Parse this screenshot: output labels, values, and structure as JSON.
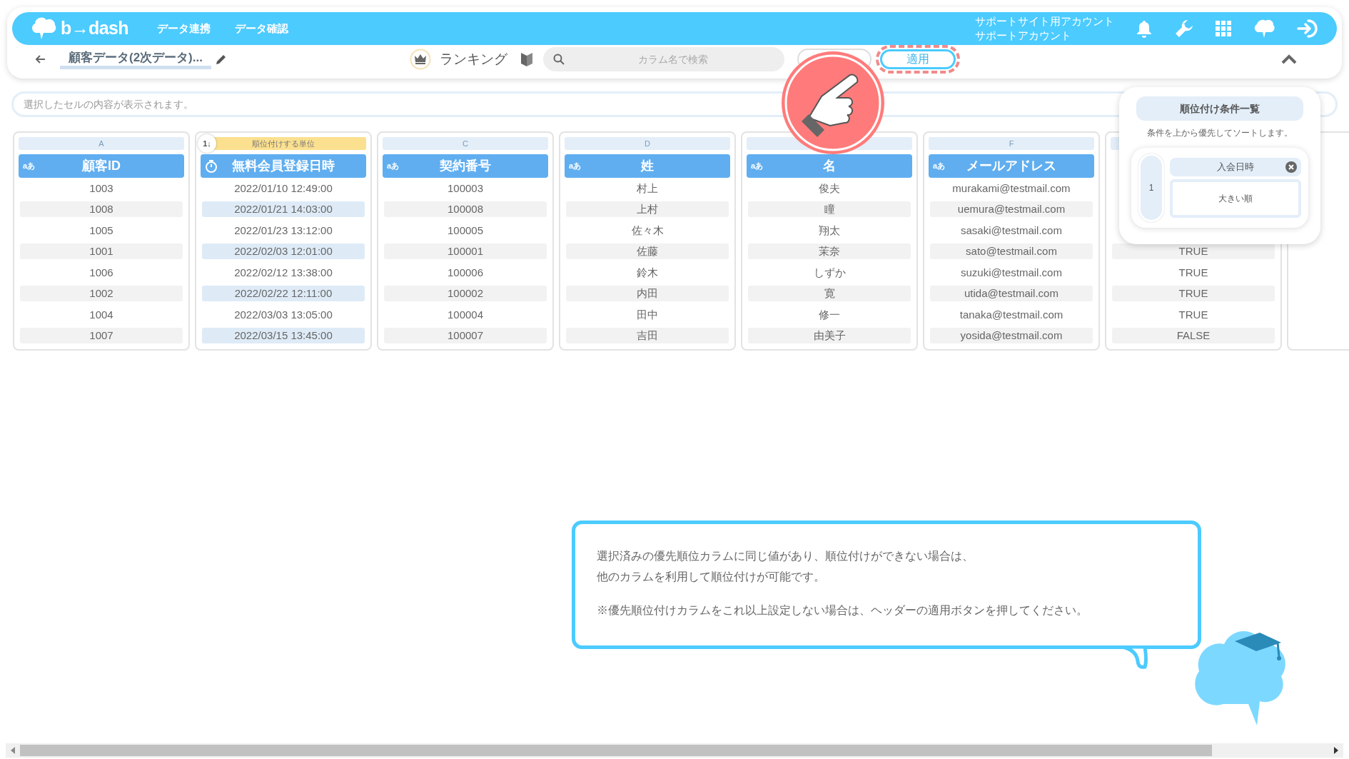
{
  "app_bar": {
    "logo": "b→dash",
    "nav": [
      "データ連携",
      "データ確認"
    ],
    "account": [
      "サポートサイト用アカウント",
      "サポートアカウント"
    ]
  },
  "toolbar": {
    "dataset_title": "顧客データ(2次データ)...",
    "mode": "ランキング",
    "search": {
      "placeholder": "カラム名で検索"
    },
    "apply_button": "適用"
  },
  "cell_viewer": {
    "placeholder": "選択したセルの内容が表示されます。"
  },
  "columns": [
    {
      "letter": "A",
      "kind": "text",
      "type_label": "aあ",
      "title": "顧客ID",
      "selected": false,
      "cells": [
        "1003",
        "1008",
        "1005",
        "1001",
        "1006",
        "1002",
        "1004",
        "1007"
      ]
    },
    {
      "rank_label": "順位付けする単位",
      "rank_badge": "1↓",
      "kind": "datetime",
      "title": "無料会員登録日時",
      "selected": true,
      "cells": [
        "2022/01/10 12:49:00",
        "2022/01/21 14:03:00",
        "2022/01/23 13:12:00",
        "2022/02/03 12:01:00",
        "2022/02/12 13:38:00",
        "2022/02/22 12:11:00",
        "2022/03/03 13:05:00",
        "2022/03/15 13:45:00"
      ]
    },
    {
      "letter": "C",
      "kind": "text",
      "type_label": "aあ",
      "title": "契約番号",
      "selected": false,
      "cells": [
        "100003",
        "100008",
        "100005",
        "100001",
        "100006",
        "100002",
        "100004",
        "100007"
      ]
    },
    {
      "letter": "D",
      "kind": "text",
      "type_label": "aあ",
      "title": "姓",
      "selected": false,
      "cells": [
        "村上",
        "上村",
        "佐々木",
        "佐藤",
        "鈴木",
        "内田",
        "田中",
        "吉田"
      ]
    },
    {
      "kind": "text",
      "type_label": "aあ",
      "title": "名",
      "selected": false,
      "cells": [
        "俊夫",
        "瞳",
        "翔太",
        "茉奈",
        "しずか",
        "寛",
        "修一",
        "由美子"
      ]
    },
    {
      "letter": "F",
      "kind": "text",
      "type_label": "aあ",
      "title": "メールアドレス",
      "selected": false,
      "cells": [
        "murakami@testmail.com",
        "uemura@testmail.com",
        "sasaki@testmail.com",
        "sato@testmail.com",
        "suzuki@testmail.com",
        "utida@testmail.com",
        "tanaka@testmail.com",
        "yosida@testmail.com"
      ]
    },
    {
      "selected": false,
      "cells": [
        "TRUE",
        "TRUE",
        "TRUE",
        "TRUE",
        "FALSE"
      ]
    }
  ],
  "ranking_panel": {
    "title": "順位付け条件一覧",
    "hint": "条件を上から優先してソートします。",
    "conditions": [
      {
        "order": "1",
        "column": "入会日時",
        "direction": "大きい順"
      }
    ]
  },
  "tip": {
    "lines": [
      "選択済みの優先順位カラムに同じ値があり、順位付けができない場合は、",
      "他のカラムを利用して順位付けが可能です。",
      "※優先順位付けカラムをこれ以上設定しない場合は、ヘッダーの適用ボタンを押してください。"
    ]
  }
}
